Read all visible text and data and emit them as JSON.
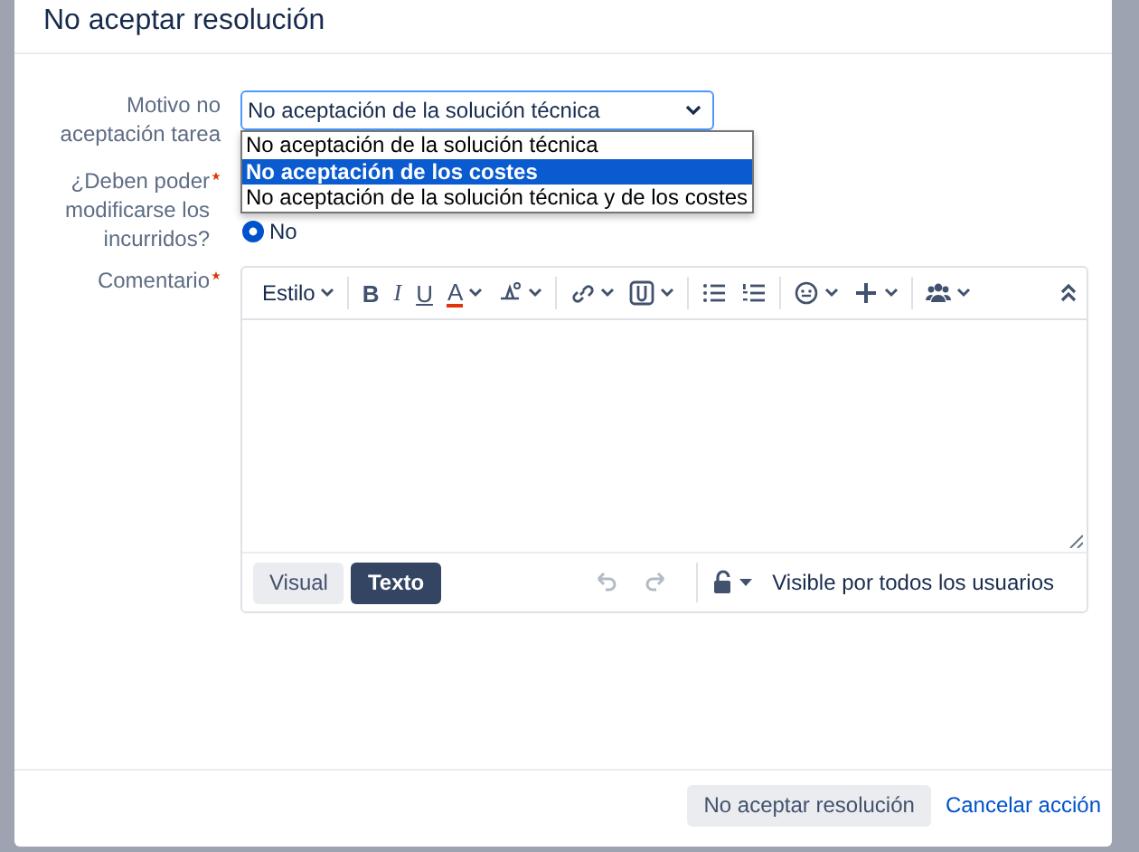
{
  "dialog": {
    "title": "No aceptar resolución",
    "fields": [
      {
        "kind": "select",
        "label": "Motivo no aceptación tarea",
        "required": false,
        "value": "No aceptación de la solución técnica",
        "expanded": true,
        "options": [
          {
            "label": "No aceptación de la solución técnica",
            "highlighted": false
          },
          {
            "label": "No aceptación de los costes",
            "highlighted": true
          },
          {
            "label": "No aceptación de la solución técnica y de los costes",
            "highlighted": false
          }
        ]
      },
      {
        "kind": "radio",
        "label": "¿Deben poder modificarse los incurridos?",
        "required": true,
        "options": [
          {
            "label": "No",
            "selected": true
          }
        ]
      },
      {
        "kind": "editor",
        "label": "Comentario",
        "required": true,
        "toolbar": [
          {
            "items": [
              {
                "kind": "style",
                "label": "Estilo",
                "menu": true
              }
            ]
          },
          {
            "items": [
              {
                "kind": "bold",
                "label": "B",
                "menu": false
              },
              {
                "kind": "italic",
                "label": "I",
                "menu": false
              },
              {
                "kind": "underline",
                "label": "U",
                "menu": false
              },
              {
                "kind": "color",
                "label": "A",
                "menu": true
              },
              {
                "kind": "format",
                "menu": true
              }
            ]
          },
          {
            "items": [
              {
                "kind": "link",
                "menu": true
              },
              {
                "kind": "attachment",
                "menu": true
              }
            ]
          },
          {
            "items": [
              {
                "kind": "bullets",
                "menu": false
              },
              {
                "kind": "numbers",
                "menu": false
              }
            ]
          },
          {
            "items": [
              {
                "kind": "emoji",
                "menu": true
              },
              {
                "kind": "plus",
                "menu": true
              }
            ]
          },
          {
            "items": [
              {
                "kind": "people",
                "menu": true
              }
            ]
          }
        ],
        "modes": [
          {
            "label": "Visual",
            "selected": false
          },
          {
            "label": "Texto",
            "selected": true
          }
        ],
        "history": [
          {
            "kind": "undo",
            "disabled": true
          },
          {
            "kind": "redo",
            "disabled": true
          }
        ],
        "visibility": "Visible por todos los usuarios"
      }
    ],
    "footer": [
      {
        "kind": "button",
        "label": "No aceptar resolución"
      },
      {
        "kind": "link",
        "label": "Cancelar acción"
      }
    ]
  }
}
